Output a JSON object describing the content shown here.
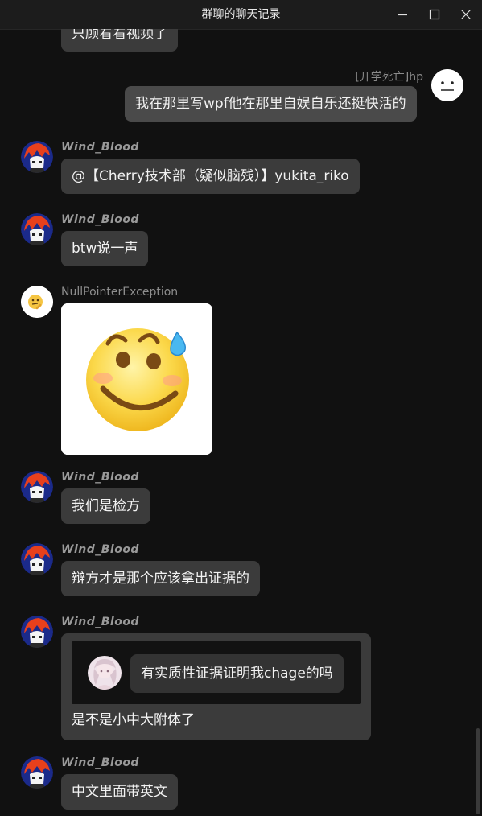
{
  "window": {
    "title": "群聊的聊天记录"
  },
  "messages": [
    {
      "kind": "text",
      "text": "只顾看看视频了"
    },
    {
      "kind": "text-mine",
      "sender": "[开学死亡]hp",
      "text": "我在那里写wpf他在那里自娱自乐还挺快活的"
    },
    {
      "kind": "text",
      "sender": "Wind_Blood",
      "text": "@【Cherry技术部（疑似脑残）】yukita_riko"
    },
    {
      "kind": "text",
      "sender": "Wind_Blood",
      "text": "btw说一声"
    },
    {
      "kind": "image",
      "sender": "NullPointerException",
      "image": "sweat-smile-emoji"
    },
    {
      "kind": "text",
      "sender": "Wind_Blood",
      "text": "我们是检方"
    },
    {
      "kind": "text",
      "sender": "Wind_Blood",
      "text": "辩方才是那个应该拿出证据的"
    },
    {
      "kind": "reply",
      "sender": "Wind_Blood",
      "quote": "有实质性证据证明我chage的吗",
      "text": "是不是小中大附体了"
    },
    {
      "kind": "text",
      "sender": "Wind_Blood",
      "text": "中文里面带英文"
    }
  ],
  "icons": {
    "minimize": "minimize-icon",
    "maximize": "maximize-icon",
    "close": "close-icon"
  },
  "colors": {
    "background": "#111111",
    "bubble": "#3b3b3b",
    "titlebar": "#1c1c1c"
  }
}
